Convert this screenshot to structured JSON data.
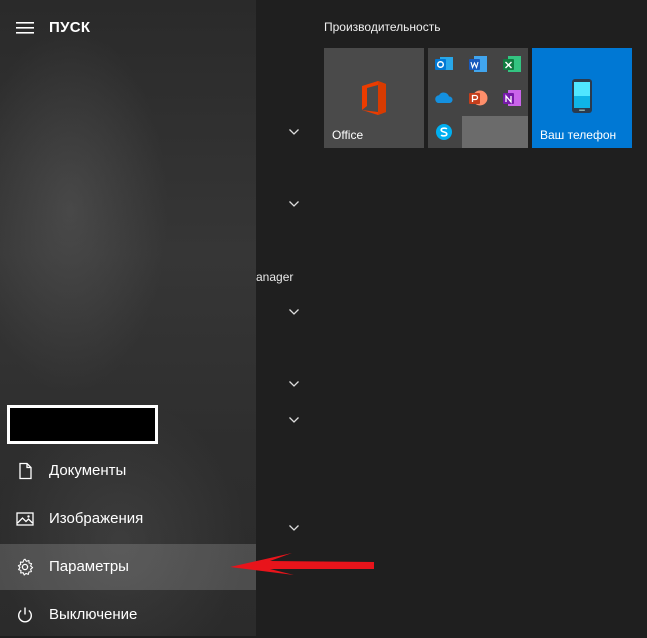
{
  "start": {
    "title": "ПУСК",
    "menu_icon": "hamburger-menu-icon"
  },
  "applist": {
    "truncated_item": "anager"
  },
  "nav": {
    "items": [
      {
        "id": "documents",
        "label": "Документы",
        "icon": "document-icon"
      },
      {
        "id": "pictures",
        "label": "Изображения",
        "icon": "image-icon"
      },
      {
        "id": "settings",
        "label": "Параметры",
        "icon": "gear-icon"
      },
      {
        "id": "power",
        "label": "Выключение",
        "icon": "power-icon"
      }
    ]
  },
  "tiles": {
    "group_title": "Производительность",
    "office": {
      "label": "Office",
      "icon": "office-icon"
    },
    "folder": {
      "apps": [
        "outlook-icon",
        "word-icon",
        "excel-icon",
        "onedrive-icon",
        "powerpoint-icon",
        "onenote-icon",
        "skype-icon"
      ]
    },
    "phone": {
      "label": "Ваш телефон",
      "icon": "phone-icon"
    }
  },
  "colors": {
    "accent": "#0078d4",
    "annotation_arrow": "#e8141b"
  }
}
